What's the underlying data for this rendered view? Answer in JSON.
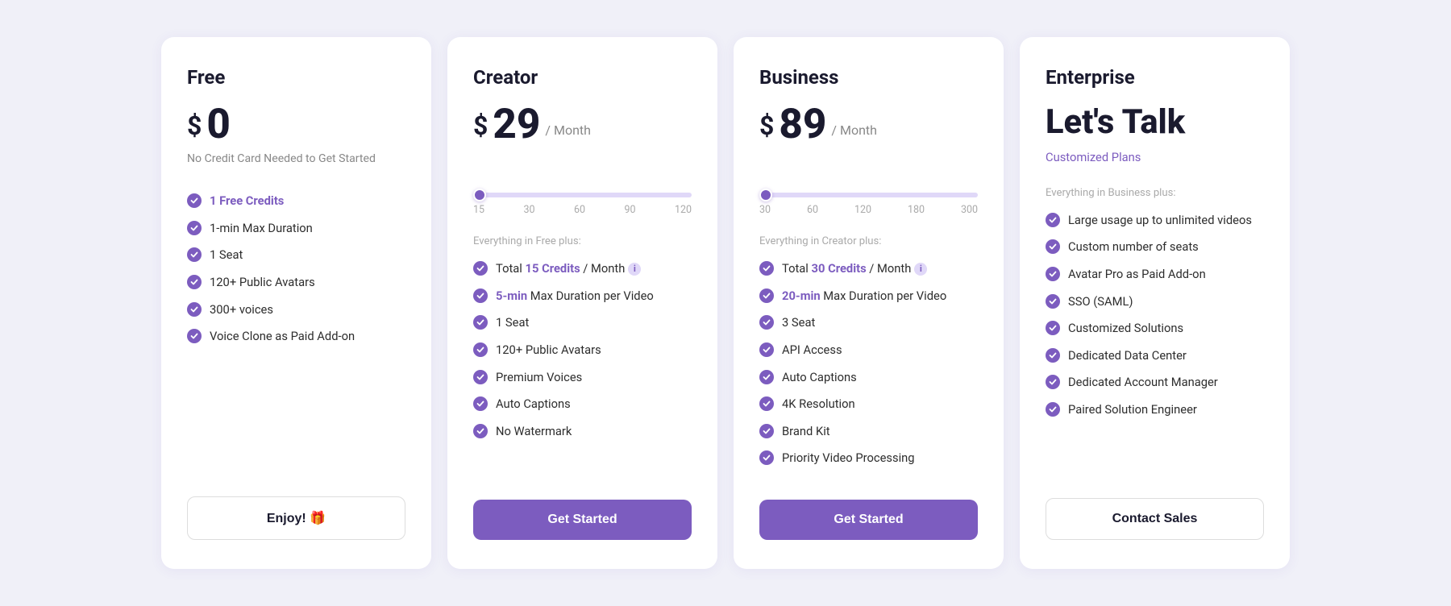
{
  "plans": [
    {
      "id": "free",
      "name": "Free",
      "price_symbol": "$",
      "price_amount": "0",
      "price_period": null,
      "price_note": "No Credit Card Needed to Get Started",
      "has_slider": false,
      "section_label": null,
      "features": [
        {
          "text": "1 Free Credits",
          "highlight": "1 Free Credits"
        },
        {
          "text": "1-min Max Duration"
        },
        {
          "text": "1 Seat"
        },
        {
          "text": "120+ Public Avatars"
        },
        {
          "text": "300+ voices"
        },
        {
          "text": "Voice Clone as Paid Add-on"
        }
      ],
      "button_label": "Enjoy! 🎁",
      "button_type": "enjoy"
    },
    {
      "id": "creator",
      "name": "Creator",
      "price_symbol": "$",
      "price_amount": "29",
      "price_period": "/ Month",
      "price_note": "",
      "has_slider": true,
      "slider_value_pct": 0,
      "slider_labels": [
        "15",
        "30",
        "60",
        "90",
        "120"
      ],
      "section_label": "Everything in Free plus:",
      "features": [
        {
          "text": "Total 15 Credits / Month",
          "highlight": "15 Credits",
          "info": true
        },
        {
          "text": "5-min Max Duration per Video",
          "highlight": "5-min"
        },
        {
          "text": "1 Seat"
        },
        {
          "text": "120+ Public Avatars"
        },
        {
          "text": "Premium Voices"
        },
        {
          "text": "Auto Captions"
        },
        {
          "text": "No Watermark"
        }
      ],
      "button_label": "Get Started",
      "button_type": "primary"
    },
    {
      "id": "business",
      "name": "Business",
      "price_symbol": "$",
      "price_amount": "89",
      "price_period": "/ Month",
      "price_note": "",
      "has_slider": true,
      "slider_value_pct": 0,
      "slider_labels": [
        "30",
        "60",
        "120",
        "180",
        "300"
      ],
      "section_label": "Everything in Creator plus:",
      "features": [
        {
          "text": "Total 30 Credits / Month",
          "highlight": "30 Credits",
          "info": true
        },
        {
          "text": "20-min Max Duration per Video",
          "highlight": "20-min"
        },
        {
          "text": "3 Seat"
        },
        {
          "text": "API Access"
        },
        {
          "text": "Auto Captions"
        },
        {
          "text": "4K Resolution"
        },
        {
          "text": "Brand Kit"
        },
        {
          "text": "Priority Video Processing"
        }
      ],
      "button_label": "Get Started",
      "button_type": "primary"
    },
    {
      "id": "enterprise",
      "name": "Enterprise",
      "price_symbol": null,
      "price_amount": null,
      "lets_talk": "Let's Talk",
      "customized_plans": "Customized Plans",
      "has_slider": false,
      "section_label": "Everything in Business plus:",
      "features": [
        {
          "text": "Large usage up to unlimited videos"
        },
        {
          "text": "Custom number of seats"
        },
        {
          "text": "Avatar Pro as Paid Add-on"
        },
        {
          "text": "SSO (SAML)"
        },
        {
          "text": "Customized Solutions"
        },
        {
          "text": "Dedicated Data Center"
        },
        {
          "text": "Dedicated Account Manager"
        },
        {
          "text": "Paired Solution Engineer"
        }
      ],
      "button_label": "Contact Sales",
      "button_type": "contact"
    }
  ]
}
